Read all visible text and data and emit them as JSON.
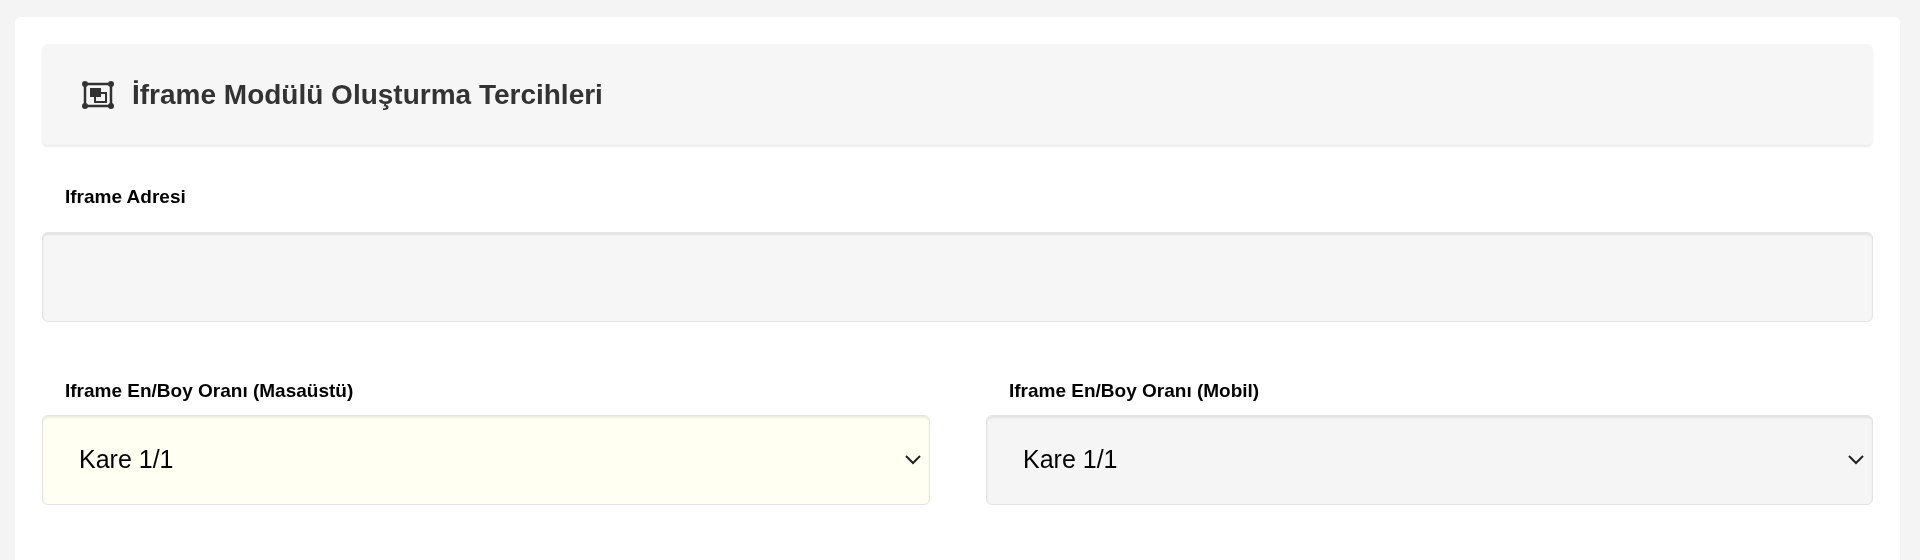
{
  "panel": {
    "title": "İframe Modülü Oluşturma Tercihleri"
  },
  "address_field": {
    "label": "Iframe Adresi"
  },
  "ratio_selects": [
    {
      "label": "Iframe En/Boy Oranı (Masaüstü)",
      "value": "Kare 1/1",
      "color": "#fffff2"
    },
    {
      "label": "Iframe En/Boy Oranı (Mobil)",
      "value": "Kare 1/1",
      "color": "#f5f5f5"
    }
  ]
}
